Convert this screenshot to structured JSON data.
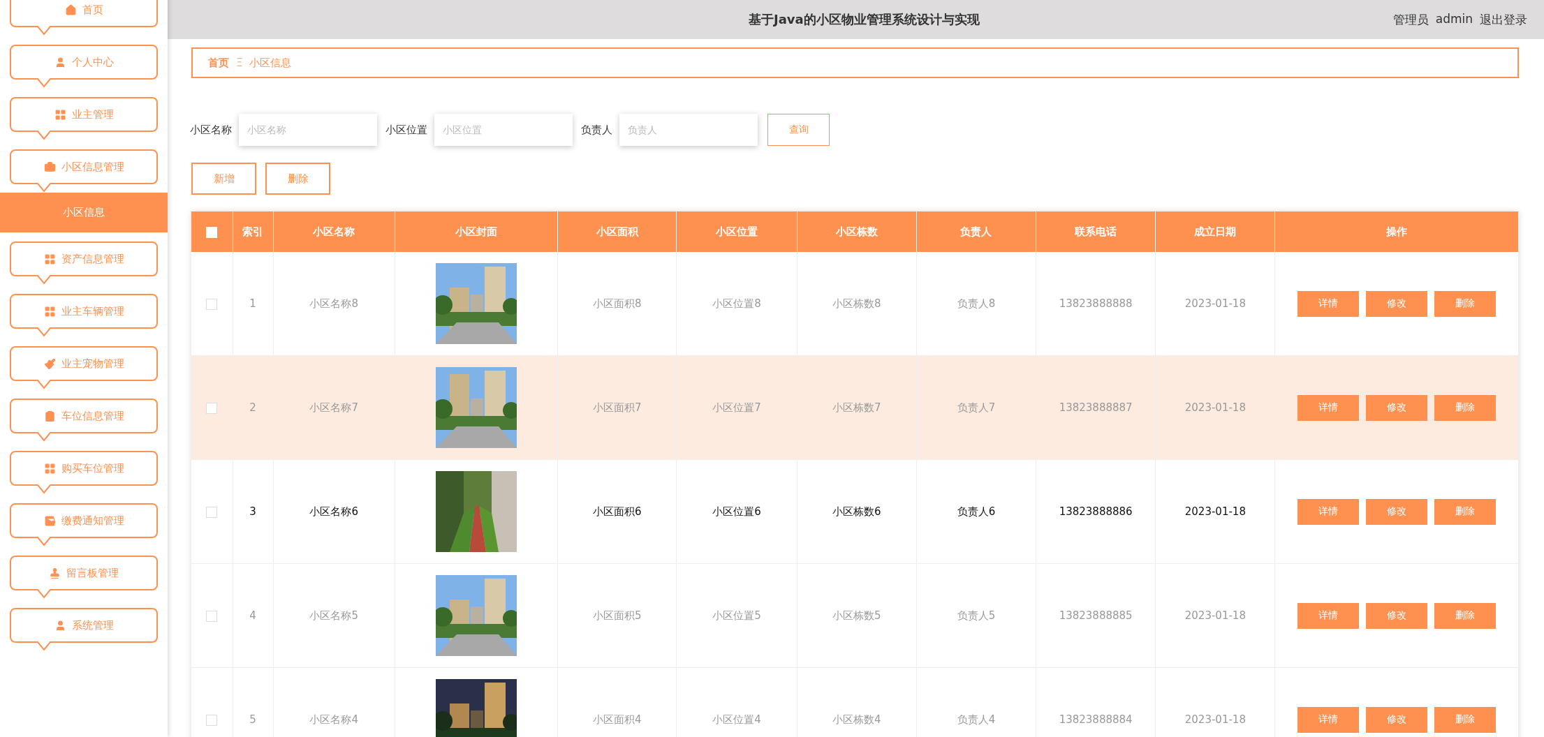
{
  "header": {
    "title": "基于Java的小区物业管理系统设计与实现",
    "user_role": "管理员",
    "user_name": "admin",
    "logout": "退出登录"
  },
  "sidebar": {
    "items": [
      {
        "label": "首页",
        "kind": "menu",
        "selected": false
      },
      {
        "label": "个人中心",
        "kind": "menu",
        "selected": false
      },
      {
        "label": "业主管理",
        "kind": "menu",
        "selected": false
      },
      {
        "label": "小区信息管理",
        "kind": "menu",
        "selected": false
      },
      {
        "label": "小区信息",
        "kind": "submenu",
        "selected": true
      },
      {
        "label": "资产信息管理",
        "kind": "menu",
        "selected": false
      },
      {
        "label": "业主车辆管理",
        "kind": "menu",
        "selected": false
      },
      {
        "label": "业主宠物管理",
        "kind": "menu",
        "selected": false
      },
      {
        "label": "车位信息管理",
        "kind": "menu",
        "selected": false
      },
      {
        "label": "购买车位管理",
        "kind": "menu",
        "selected": false
      },
      {
        "label": "缴费通知管理",
        "kind": "menu",
        "selected": false
      },
      {
        "label": "留言板管理",
        "kind": "menu",
        "selected": false
      },
      {
        "label": "系统管理",
        "kind": "menu",
        "selected": false
      }
    ]
  },
  "breadcrumb": {
    "home": "首页",
    "separator": "Ξ",
    "current": "小区信息"
  },
  "search": {
    "fields": [
      {
        "label": "小区名称",
        "placeholder": "小区名称"
      },
      {
        "label": "小区位置",
        "placeholder": "小区位置"
      },
      {
        "label": "负责人",
        "placeholder": "负责人"
      }
    ],
    "button": "查询"
  },
  "actions": [
    "新增",
    "删除"
  ],
  "table": {
    "select_all": {
      "checked": false
    },
    "columns": [
      "索引",
      "小区名称",
      "小区封面",
      "小区面积",
      "小区位置",
      "小区栋数",
      "负责人",
      "联系电话",
      "成立日期",
      "操作"
    ],
    "rows": [
      {
        "checked": false,
        "highlighted": false,
        "hovered": false,
        "index": "1",
        "name": "小区名称8",
        "area": "小区面积8",
        "location": "小区位置8",
        "buildings": "小区栋数8",
        "manager": "负责人8",
        "phone": "13823888888",
        "date": "2023-01-18",
        "buttons": [
          "详情",
          "修改",
          "删除"
        ]
      },
      {
        "checked": false,
        "highlighted": true,
        "hovered": false,
        "index": "2",
        "name": "小区名称7",
        "area": "小区面积7",
        "location": "小区位置7",
        "buildings": "小区栋数7",
        "manager": "负责人7",
        "phone": "13823888887",
        "date": "2023-01-18",
        "buttons": [
          "详情",
          "修改",
          "删除"
        ]
      },
      {
        "checked": false,
        "highlighted": false,
        "hovered": true,
        "index": "3",
        "name": "小区名称6",
        "area": "小区面积6",
        "location": "小区位置6",
        "buildings": "小区栋数6",
        "manager": "负责人6",
        "phone": "13823888886",
        "date": "2023-01-18",
        "buttons": [
          "详情",
          "修改",
          "删除"
        ]
      },
      {
        "checked": false,
        "highlighted": false,
        "hovered": false,
        "index": "4",
        "name": "小区名称5",
        "area": "小区面积5",
        "location": "小区位置5",
        "buildings": "小区栋数5",
        "manager": "负责人5",
        "phone": "13823888885",
        "date": "2023-01-18",
        "buttons": [
          "详情",
          "修改",
          "删除"
        ]
      },
      {
        "checked": false,
        "highlighted": false,
        "hovered": false,
        "index": "5",
        "name": "小区名称4",
        "area": "小区面积4",
        "location": "小区位置4",
        "buildings": "小区栋数4",
        "manager": "负责人4",
        "phone": "13823888884",
        "date": "2023-01-18",
        "buttons": [
          "详情",
          "修改",
          "删除"
        ]
      }
    ]
  }
}
